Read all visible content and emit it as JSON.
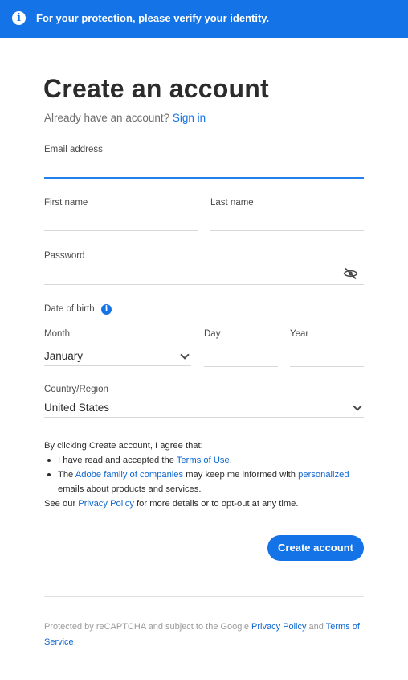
{
  "banner": {
    "icon": "info-icon",
    "text": "For your protection, please verify your identity."
  },
  "page": {
    "title": "Create an account",
    "already_have": "Already have an account?",
    "sign_in": "Sign in"
  },
  "form": {
    "email_label": "Email address",
    "email_value": "",
    "first_name_label": "First name",
    "first_name_value": "",
    "last_name_label": "Last name",
    "last_name_value": "",
    "password_label": "Password",
    "password_value": "",
    "password_toggle_icon": "eye-slash-icon",
    "dob_label": "Date of birth",
    "dob_info_icon": "info-icon",
    "month_label": "Month",
    "month_value": "January",
    "day_label": "Day",
    "day_value": "",
    "year_label": "Year",
    "year_value": "",
    "country_label": "Country/Region",
    "country_value": "United States"
  },
  "terms": {
    "intro": "By clicking Create account, I agree that:",
    "item1_pre": "I have read and accepted the ",
    "item1_link": "Terms of Use",
    "item1_post": ".",
    "item2_pre": "The ",
    "item2_link1": "Adobe family of companies",
    "item2_mid": " may keep me informed with ",
    "item2_link2": "personalized",
    "item2_post": " emails about products and services.",
    "see_pre": "See our ",
    "see_link": "Privacy Policy",
    "see_post": " for more details or to opt-out at any time."
  },
  "actions": {
    "create_account": "Create account"
  },
  "footer": {
    "pre": "Protected by reCAPTCHA and subject to the Google ",
    "privacy": "Privacy Policy",
    "and": " and ",
    "terms": "Terms of Service",
    "post": "."
  },
  "colors": {
    "brand_blue": "#1473e6",
    "focus_blue": "#2680eb",
    "link_blue": "#1473e6"
  }
}
